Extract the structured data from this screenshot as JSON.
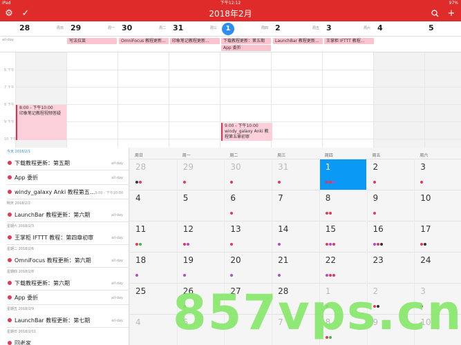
{
  "status": {
    "left": "iPad",
    "time": "下午12:12",
    "battery": "97%"
  },
  "nav": {
    "title": "2018年2月"
  },
  "week": [
    {
      "num": "28",
      "wk": "周日",
      "today": false
    },
    {
      "num": "29",
      "wk": "周一",
      "today": false
    },
    {
      "num": "30",
      "wk": "周二",
      "today": false
    },
    {
      "num": "31",
      "wk": "周三",
      "today": false
    },
    {
      "num": "1",
      "wk": "周四",
      "today": true
    },
    {
      "num": "2",
      "wk": "周五",
      "today": false
    },
    {
      "num": "3",
      "wk": "周六",
      "today": false
    },
    {
      "num": "4",
      "wk": "",
      "today": false
    },
    {
      "num": "5",
      "wk": "",
      "today": false
    }
  ],
  "allday": {
    "label": "all-day",
    "events": [
      {
        "title": "写法拉莱"
      },
      {
        "title": "OmniFocus 教程更新..."
      },
      {
        "title": "印象笔记教程更新..."
      },
      {
        "title": "下载教程更新：第五期"
      },
      {
        "title": "App 委折"
      },
      {
        "title": "LaunchBar 教程更新..."
      },
      {
        "title": "王掌柜 IFTTT 教程..."
      }
    ]
  },
  "hours": [
    "6 下午",
    "7 下午",
    "8 下午",
    "9 下午",
    "10 下午"
  ],
  "timed": [
    {
      "time": "8:00 - 下午10:00",
      "title": "印象笔记教程视频答疑"
    },
    {
      "time": "9:00 - 下午10:00",
      "title": "windy_galaxy Anki 教程第五章初审"
    }
  ],
  "agenda": [
    {
      "head": "今天 2018/2/1",
      "today": true,
      "items": [
        {
          "title": "下载教程更新：第五期",
          "time": "all-day"
        },
        {
          "title": "App 委折",
          "time": "all-day"
        },
        {
          "title": "windy_galaxy Anki 教程第五...",
          "time": "9:00 - 下午10:00"
        }
      ]
    },
    {
      "head": "明天 2018/2/2",
      "today": false,
      "items": [
        {
          "title": "LaunchBar 教程更新：第六期",
          "time": "all-day"
        }
      ]
    },
    {
      "head": "星期六 2018/2/3",
      "today": false,
      "items": [
        {
          "title": "王掌柜 IFTTT 教程：第四章初审",
          "time": "all-day"
        }
      ]
    },
    {
      "head": "星期二 2018/2/6",
      "today": false,
      "items": [
        {
          "title": "OmniFocus 教程更新：第六期",
          "time": "all-day"
        }
      ]
    },
    {
      "head": "星期四 2018/2/8",
      "today": false,
      "items": [
        {
          "title": "下载教程更新：第六期",
          "time": "all-day"
        },
        {
          "title": "App 委折",
          "time": "all-day"
        }
      ]
    },
    {
      "head": "星期五 2018/2/9",
      "today": false,
      "items": [
        {
          "title": "LaunchBar 教程更新：第七期",
          "time": "all-day"
        }
      ]
    },
    {
      "head": "星期日 2018/2/11",
      "today": false,
      "items": [
        {
          "title": "回老家",
          "time": ""
        }
      ]
    }
  ],
  "month": {
    "headers": [
      "周日",
      "周一",
      "周二",
      "周三",
      "周四",
      "周五",
      "周六"
    ],
    "weeks": [
      [
        {
          "d": "28",
          "dim": true,
          "dots": [
            "#333",
            "#e03a5a"
          ]
        },
        {
          "d": "29",
          "dim": true,
          "dots": [
            "#e03a5a"
          ]
        },
        {
          "d": "30",
          "dim": true,
          "dots": [
            "#e03a5a"
          ]
        },
        {
          "d": "31",
          "dim": true,
          "dots": [
            "#e03a5a"
          ]
        },
        {
          "d": "1",
          "today": true,
          "dots": [
            "#e03a5a",
            "#e03a5a",
            "#b04ad0"
          ]
        },
        {
          "d": "2",
          "dots": [
            "#e03a5a"
          ]
        },
        {
          "d": "3",
          "dots": [
            "#e03a5a"
          ]
        }
      ],
      [
        {
          "d": "4",
          "dots": []
        },
        {
          "d": "5",
          "dots": []
        },
        {
          "d": "6",
          "dots": [
            "#e03a5a"
          ]
        },
        {
          "d": "7",
          "dots": []
        },
        {
          "d": "8",
          "dots": [
            "#e03a5a",
            "#e03a5a"
          ]
        },
        {
          "d": "9",
          "dots": [
            "#e03a5a"
          ]
        },
        {
          "d": "10",
          "dots": []
        }
      ],
      [
        {
          "d": "11",
          "dots": [
            "#e03a5a",
            "#4caf50"
          ]
        },
        {
          "d": "12",
          "dots": [
            "#e03a5a",
            "#b04ad0"
          ]
        },
        {
          "d": "13",
          "dots": [
            "#e03a5a"
          ]
        },
        {
          "d": "14",
          "dots": [
            "#b04ad0"
          ]
        },
        {
          "d": "15",
          "dots": [
            "#e03a5a",
            "#b04ad0",
            "#e03a5a"
          ]
        },
        {
          "d": "16",
          "dots": [
            "#b04ad0",
            "#e03a5a",
            "#333"
          ]
        },
        {
          "d": "17",
          "dots": [
            "#e03a5a",
            "#333"
          ]
        }
      ],
      [
        {
          "d": "18",
          "dots": [
            "#b04ad0"
          ]
        },
        {
          "d": "19",
          "dots": [
            "#b04ad0"
          ]
        },
        {
          "d": "20",
          "dots": [
            "#b04ad0"
          ]
        },
        {
          "d": "21",
          "dots": [
            "#b04ad0"
          ]
        },
        {
          "d": "22",
          "dots": [
            "#b04ad0",
            "#e03a5a",
            "#e03a5a"
          ]
        },
        {
          "d": "23",
          "dots": []
        },
        {
          "d": "24",
          "dots": []
        }
      ],
      [
        {
          "d": "25",
          "dots": []
        },
        {
          "d": "26",
          "dots": [
            "#e03a5a"
          ]
        },
        {
          "d": "27",
          "dots": []
        },
        {
          "d": "28",
          "dots": []
        },
        {
          "d": "1",
          "dim": true,
          "dots": [
            "#e03a5a"
          ]
        },
        {
          "d": "2",
          "dim": true,
          "dots": [
            "#e03a5a",
            "#333"
          ]
        },
        {
          "d": "3",
          "dim": true,
          "dots": [
            "#b04ad0"
          ]
        }
      ],
      [
        {
          "d": "4",
          "dim": true,
          "dots": []
        },
        {
          "d": "5",
          "dim": true,
          "dots": []
        },
        {
          "d": "6",
          "dim": true,
          "dots": []
        },
        {
          "d": "7",
          "dim": true,
          "dots": []
        },
        {
          "d": "8",
          "dim": true,
          "dots": [
            "#e03a5a",
            "#4caf50"
          ]
        },
        {
          "d": "9",
          "dim": true,
          "dots": []
        },
        {
          "d": "10",
          "dim": true,
          "dots": []
        }
      ]
    ]
  },
  "watermark": "857vps.cn",
  "colors": {
    "accent": "#e02b2b",
    "today": "#0a9af5",
    "event": "#f9c4cf"
  }
}
